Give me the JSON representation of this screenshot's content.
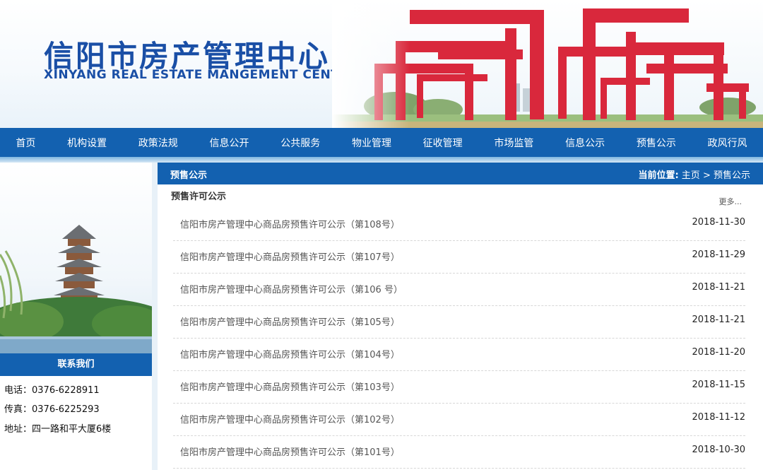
{
  "header": {
    "title_cn": "信阳市房产管理中心",
    "title_en": "XINYANG REAL ESTATE MANGEMENT CENTER"
  },
  "nav": [
    {
      "label": "首页"
    },
    {
      "label": "机构设置"
    },
    {
      "label": "政策法规"
    },
    {
      "label": "信息公开"
    },
    {
      "label": "公共服务"
    },
    {
      "label": "物业管理"
    },
    {
      "label": "征收管理"
    },
    {
      "label": "市场监管"
    },
    {
      "label": "信息公示"
    },
    {
      "label": "预售公示"
    },
    {
      "label": "政风行风"
    }
  ],
  "sidebar": {
    "contact_title": "联系我们",
    "phone": "电话：0376-6228911",
    "fax": "传真：0376-6225293",
    "address": "地址：四一路和平大厦6楼"
  },
  "main": {
    "section_title": "预售公示",
    "breadcrumb_prefix": "当前位置:",
    "breadcrumb_home": "主页",
    "breadcrumb_sep": ">",
    "breadcrumb_current": "预售公示",
    "sub_title": "预售许可公示",
    "more_label": "更多...",
    "items": [
      {
        "title": "信阳市房产管理中心商品房预售许可公示（第108号）",
        "date": "2018-11-30"
      },
      {
        "title": "信阳市房产管理中心商品房预售许可公示（第107号）",
        "date": "2018-11-29"
      },
      {
        "title": "信阳市房产管理中心商品房预售许可公示（第106 号）",
        "date": "2018-11-21"
      },
      {
        "title": "信阳市房产管理中心商品房预售许可公示（第105号）",
        "date": "2018-11-21"
      },
      {
        "title": "信阳市房产管理中心商品房预售许可公示（第104号）",
        "date": "2018-11-20"
      },
      {
        "title": "信阳市房产管理中心商品房预售许可公示（第103号）",
        "date": "2018-11-15"
      },
      {
        "title": "信阳市房产管理中心商品房预售许可公示（第102号）",
        "date": "2018-11-12"
      },
      {
        "title": "信阳市房产管理中心商品房预售许可公示（第101号）",
        "date": "2018-10-30"
      }
    ]
  },
  "colors": {
    "brand_blue": "#1361b0",
    "title_blue": "#1a4fa6",
    "sculpture_red": "#d9283c"
  }
}
